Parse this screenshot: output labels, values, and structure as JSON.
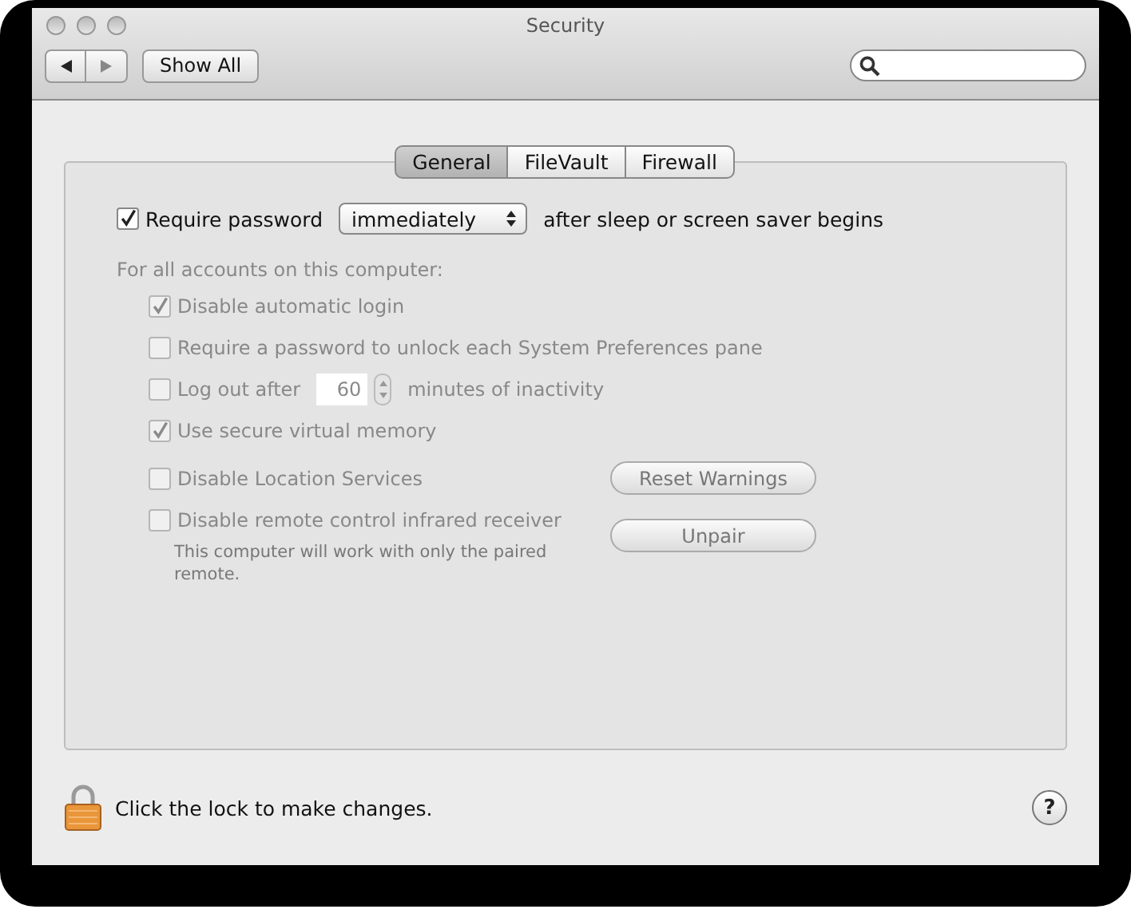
{
  "window": {
    "title": "Security"
  },
  "toolbar": {
    "show_all": "Show All"
  },
  "tabs": [
    {
      "label": "General",
      "selected": true
    },
    {
      "label": "FileVault",
      "selected": false
    },
    {
      "label": "Firewall",
      "selected": false
    }
  ],
  "require_password": {
    "checked": true,
    "label": "Require password",
    "popup": "immediately",
    "suffix": "after sleep or screen saver begins"
  },
  "accounts_heading": "For all accounts on this computer:",
  "options": [
    {
      "kind": "checkbox",
      "label": "Disable automatic login",
      "checked": true,
      "disabled": true
    },
    {
      "kind": "checkbox",
      "label": "Require a password to unlock each System Preferences pane",
      "checked": false,
      "disabled": true
    },
    {
      "kind": "stepper",
      "label": "Log out after",
      "value": "60",
      "suffix": "minutes of inactivity",
      "checked": false,
      "disabled": true
    },
    {
      "kind": "checkbox",
      "label": "Use secure virtual memory",
      "checked": true,
      "disabled": true
    }
  ],
  "location": {
    "label": "Disable Location Services",
    "checked": false,
    "disabled": true,
    "button": "Reset Warnings"
  },
  "remote": {
    "label": "Disable remote control infrared receiver",
    "checked": false,
    "disabled": true,
    "note": "This computer will work with only the paired remote.",
    "button": "Unpair"
  },
  "footer": {
    "lock_text": "Click the lock to make changes.",
    "help": "?"
  }
}
